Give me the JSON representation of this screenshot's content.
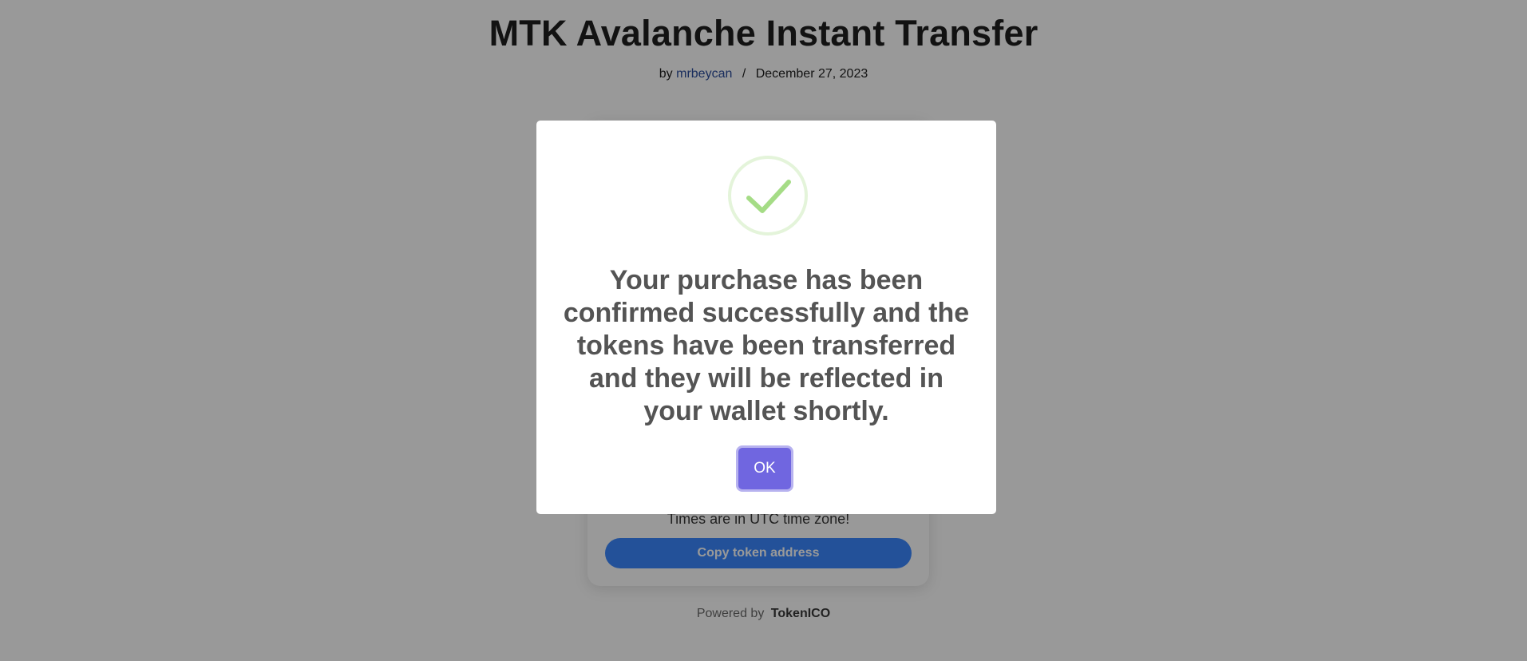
{
  "page": {
    "title": "MTK Avalanche Instant Transfer",
    "meta": {
      "by_prefix": "by",
      "author": "mrbeycan",
      "separator": "/",
      "date": "December 27, 2023"
    }
  },
  "card": {
    "timezone_note": "Times are in UTC time zone!",
    "copy_button": "Copy token address"
  },
  "footer": {
    "powered_prefix": "Powered by",
    "brand": "TokenICO"
  },
  "modal": {
    "icon": "success-check-icon",
    "message": "Your purchase has been confirmed successfully and the tokens have been transferred and they will be reflected in your wallet shortly.",
    "ok_label": "OK"
  },
  "colors": {
    "ok_button": "#7066e0",
    "copy_button": "#3b88ff",
    "success_icon": "#a5dc86",
    "author_link": "#2a4b9b"
  }
}
